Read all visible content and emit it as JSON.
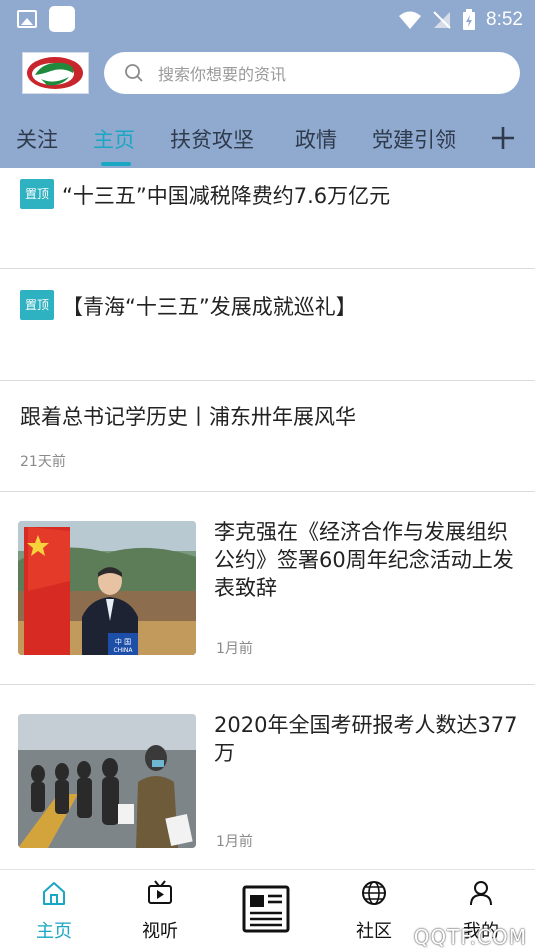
{
  "status_bar": {
    "time": "8:52"
  },
  "search": {
    "placeholder": "搜索你想要的资讯"
  },
  "tabs": [
    {
      "label": "关注",
      "active": false
    },
    {
      "label": "主页",
      "active": true
    },
    {
      "label": "扶贫攻坚",
      "active": false
    },
    {
      "label": "政情",
      "active": false
    },
    {
      "label": "党建引领",
      "active": false
    }
  ],
  "pin_label": "置顶",
  "articles": [
    {
      "title": "“十三五”中国减税降费约7.6万亿元",
      "pinned": true
    },
    {
      "title": "【青海“十三五”发展成就巡礼】",
      "pinned": true
    },
    {
      "title": "跟着总书记学历史丨浦东卅年展风华",
      "time": "21天前"
    },
    {
      "title": "李克强在《经济合作与发展组织公约》签署60周年纪念活动上发表致辞",
      "time": "1月前",
      "image_caption": "中 国\nCHINA"
    },
    {
      "title": "2020年全国考研报考人数达377万",
      "time": "1月前"
    }
  ],
  "bottom_nav": [
    {
      "label": "主页",
      "icon": "home-icon",
      "active": true
    },
    {
      "label": "视听",
      "icon": "tv-icon",
      "active": false
    },
    {
      "label": "",
      "icon": "newspaper-icon",
      "active": false
    },
    {
      "label": "社区",
      "icon": "globe-icon",
      "active": false
    },
    {
      "label": "我的",
      "icon": "user-icon",
      "active": false
    }
  ],
  "watermark": "QQTF.COM",
  "colors": {
    "header_bg": "#8fa9cf",
    "accent": "#1aa7c3",
    "pin_bg": "#2eb1c1"
  }
}
